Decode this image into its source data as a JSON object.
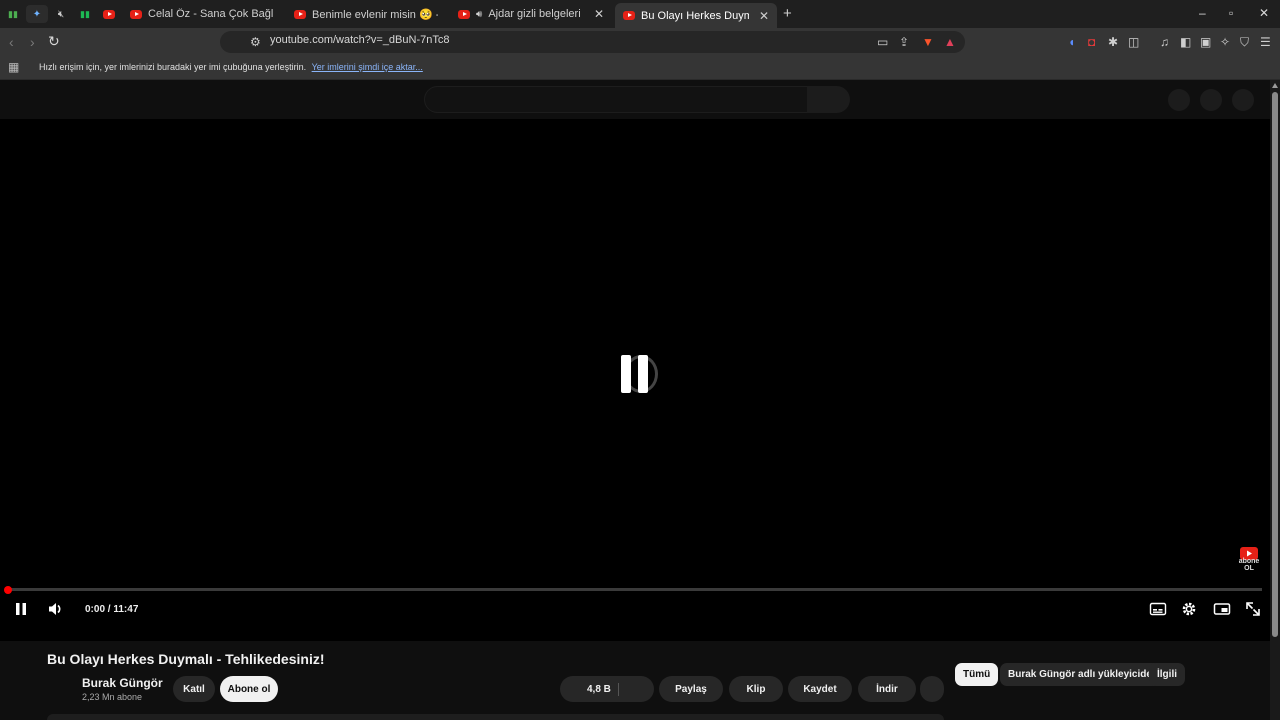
{
  "browser": {
    "tabs": [
      {
        "title": "Celal Öz - Sana Çok Bağlıyam - YouT",
        "active": false
      },
      {
        "title": "Benimle evlenir misin 🥺 - YouTube",
        "active": false
      },
      {
        "title": "Ajdar gizli belgeleri açıklıyor",
        "active": false,
        "audio": "speaker-icon"
      },
      {
        "title": "Bu Olayı Herkes Duymalı - Tehlik",
        "active": true
      }
    ],
    "new_tab": "+",
    "window_controls": {
      "minimize": "–",
      "maximize": "▫",
      "close": "✕"
    },
    "address": "youtube.com/watch?v=_dBuN-7nTc8",
    "bookmarks_bar": {
      "message": "Hızlı erişim için, yer imlerinizi buradaki yer imi çubuğuna yerleştirin.",
      "import_link": "Yer imlerini şimdi içe aktar..."
    }
  },
  "player": {
    "time": "0:00 / 11:47",
    "progress": 0.0,
    "state": "paused",
    "badge": "abone OL"
  },
  "video": {
    "title": "Bu Olayı Herkes Duymalı - Tehlikedesiniz!",
    "channel": "Burak Güngör",
    "subscribers": "2,23 Mn abone",
    "join_label": "Katıl",
    "subscribe_label": "Abone ol",
    "likes": "4,8 B",
    "share_label": "Paylaş",
    "clip_label": "Klip",
    "save_label": "Kaydet",
    "download_label": "İndir"
  },
  "filter_chips": [
    "Tümü",
    "Burak Güngör adlı yükleyiciden",
    "İlgili"
  ],
  "colors": {
    "accent": "#ff0000",
    "background": "#0f0f0f",
    "chip": "#272727"
  }
}
